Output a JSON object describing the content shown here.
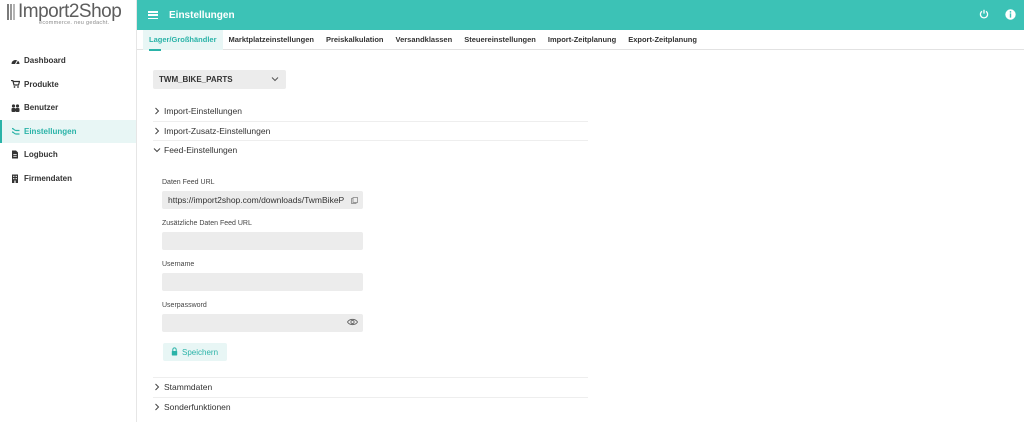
{
  "brand": {
    "name": "Import2Shop",
    "tagline": "ecommerce. neu gedacht."
  },
  "sidebar": {
    "items": [
      {
        "label": "Dashboard",
        "icon": "dashboard-icon"
      },
      {
        "label": "Produkte",
        "icon": "cart-icon"
      },
      {
        "label": "Benutzer",
        "icon": "users-icon"
      },
      {
        "label": "Einstellungen",
        "icon": "settings-icon",
        "active": true
      },
      {
        "label": "Logbuch",
        "icon": "logbook-icon"
      },
      {
        "label": "Firmendaten",
        "icon": "building-icon"
      }
    ]
  },
  "header": {
    "title": "Einstellungen",
    "actions": [
      "power-icon",
      "info-icon"
    ]
  },
  "tabs": [
    {
      "label": "Lager/Großhändler",
      "active": true
    },
    {
      "label": "Marktplatzeinstellungen"
    },
    {
      "label": "Preiskalkulation"
    },
    {
      "label": "Versandklassen"
    },
    {
      "label": "Steuereinstellungen"
    },
    {
      "label": "Import-Zeitplanung"
    },
    {
      "label": "Export-Zeitplanung"
    }
  ],
  "supplier_select": {
    "value": "TWM_BIKE_PARTS"
  },
  "sections": {
    "import": "Import-Einstellungen",
    "import_extra": "Import-Zusatz-Einstellungen",
    "feed": "Feed-Einstellungen",
    "master": "Stammdaten",
    "special": "Sonderfunktionen"
  },
  "feed_form": {
    "data_feed_url_label": "Daten Feed URL",
    "data_feed_url_value": "https://import2shop.com/downloads/TwmBikeP",
    "extra_feed_url_label": "Zusätzliche Daten Feed URL",
    "extra_feed_url_value": "",
    "username_label": "Username",
    "username_value": "",
    "password_label": "Userpassword",
    "password_value": "",
    "save_label": "Speichern"
  },
  "colors": {
    "accent": "#3cc2b6",
    "accent_text": "#2ab3a8",
    "accent_light": "#e8f6f5",
    "field_bg": "#ececec"
  }
}
